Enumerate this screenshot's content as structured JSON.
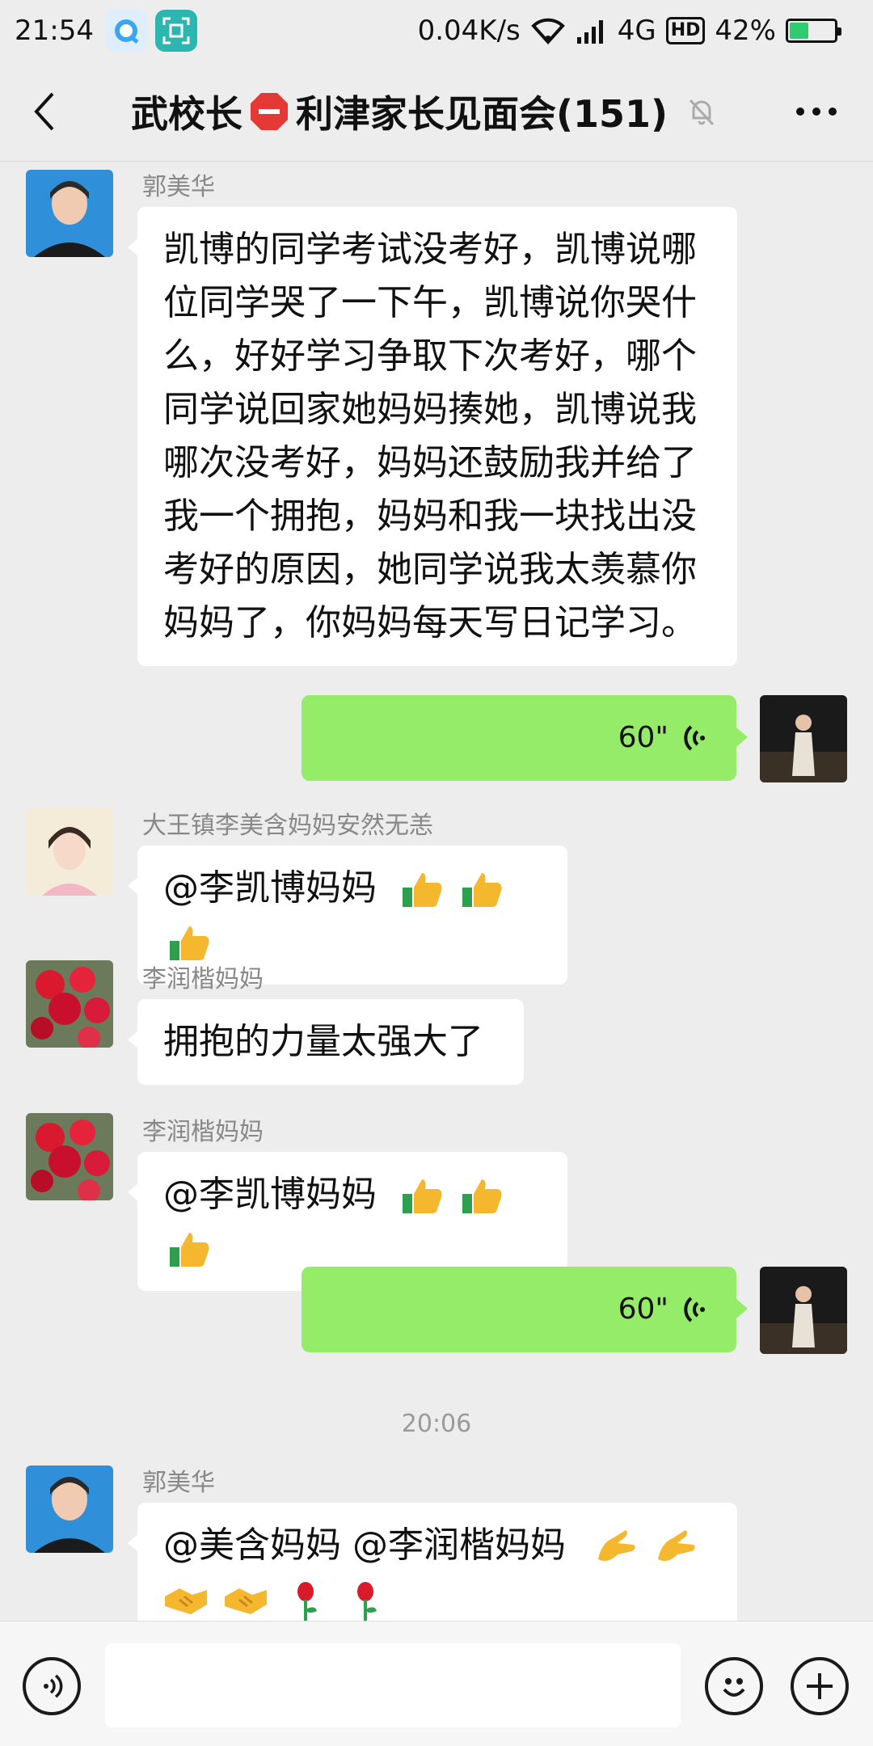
{
  "status_bar": {
    "time": "21:54",
    "net_speed": "0.04K/s",
    "network": "4G",
    "hd": "HD",
    "battery": "42%",
    "battery_level": 0.42
  },
  "header": {
    "title_prefix": "武校长",
    "title_suffix": "利津家长见面会(151)"
  },
  "messages": [
    {
      "sender": "郭美华",
      "lines": [
        "凯博的同学考试没考好，凯博说哪",
        "位同学哭了一下午，凯博说你哭什",
        "么，好好学习争取下次考好，哪个",
        "同学说回家她妈妈揍她，凯博说我",
        "哪次没考好，妈妈还鼓励我并给了",
        "我一个拥抱，妈妈和我一块找出没",
        "考好的原因，她同学说我太羡慕你",
        "妈妈了，你妈妈每天写日记学习。"
      ]
    },
    {
      "voice_duration": "60\""
    },
    {
      "sender": "大王镇李美含妈妈安然无恙",
      "text": "@李凯博妈妈"
    },
    {
      "sender": "李润楷妈妈",
      "text": "拥抱的力量太强大了"
    },
    {
      "sender": "李润楷妈妈",
      "text": "@李凯博妈妈"
    },
    {
      "voice_duration": "60\""
    },
    {
      "timestamp": "20:06"
    },
    {
      "sender": "郭美华",
      "text": "@美含妈妈  @李润楷妈妈"
    }
  ],
  "colors": {
    "voice_bubble": "#95ec69",
    "background": "#ededed"
  }
}
